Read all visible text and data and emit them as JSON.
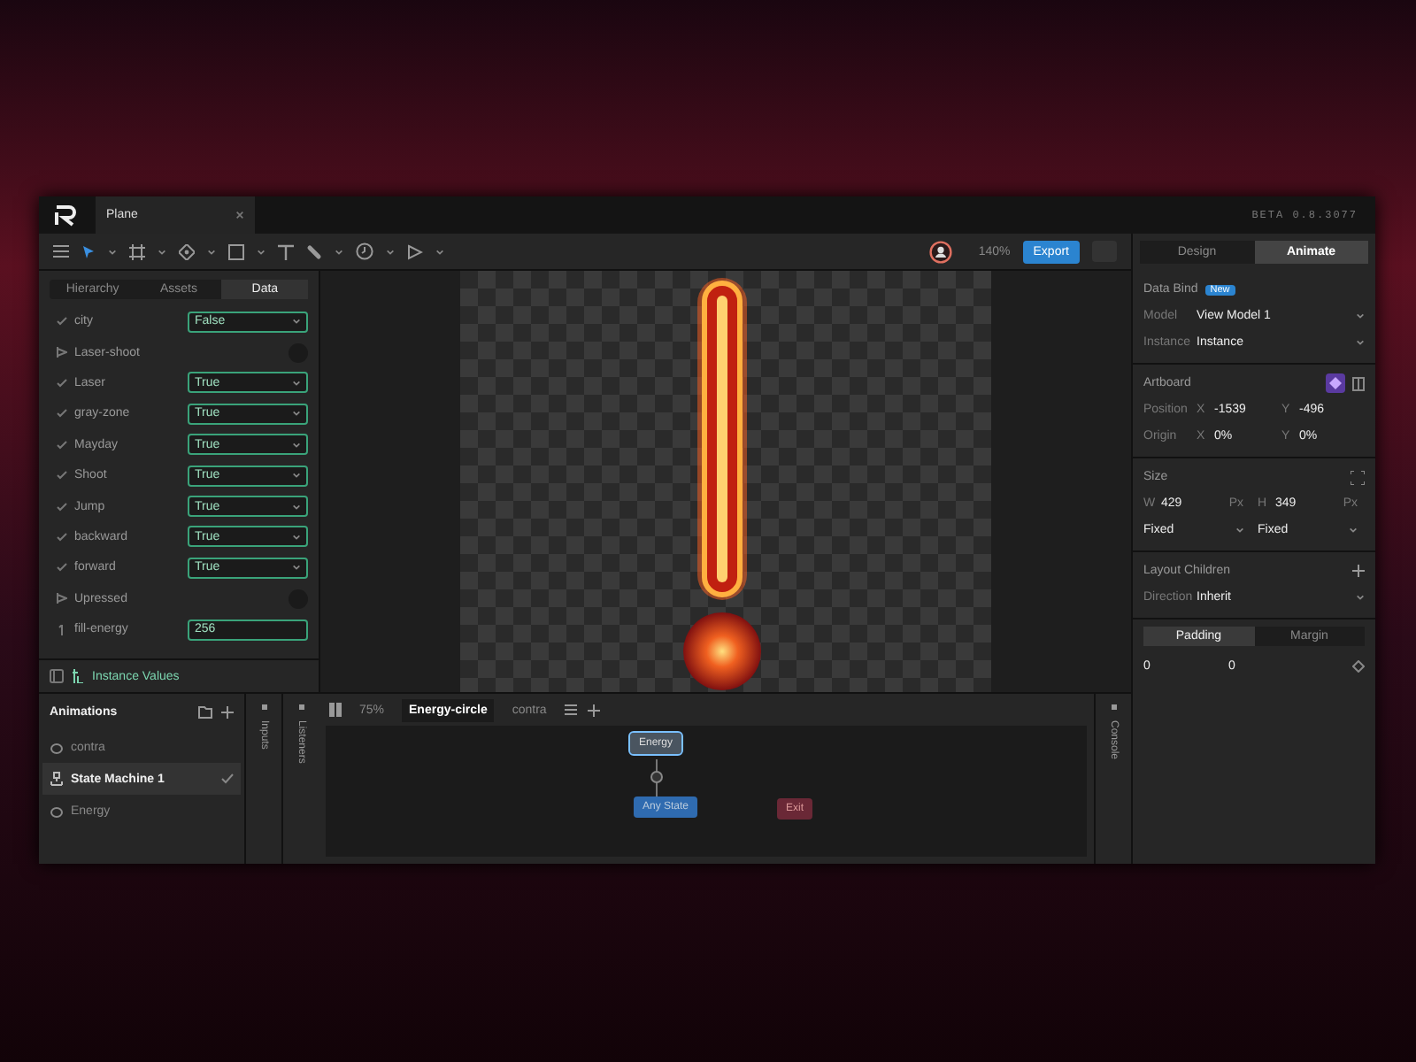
{
  "app_tab": {
    "title": "Plane"
  },
  "version": "BETA 0.8.3077",
  "toolbar": {
    "zoom": "140%",
    "export": "Export"
  },
  "mode_tabs": [
    {
      "label": "Design",
      "selected": false
    },
    {
      "label": "Animate",
      "selected": true
    }
  ],
  "panel_tabs": [
    {
      "label": "Hierarchy",
      "selected": false
    },
    {
      "label": "Assets",
      "selected": false
    },
    {
      "label": "Data",
      "selected": true
    }
  ],
  "data_rows": [
    {
      "kind": "bool",
      "name": "city",
      "value": "False"
    },
    {
      "kind": "trigger",
      "name": "Laser-shoot"
    },
    {
      "kind": "bool",
      "name": "Laser",
      "value": "True"
    },
    {
      "kind": "bool",
      "name": "gray-zone",
      "value": "True"
    },
    {
      "kind": "bool",
      "name": "Mayday",
      "value": "True"
    },
    {
      "kind": "bool",
      "name": "Shoot",
      "value": "True"
    },
    {
      "kind": "bool",
      "name": "Jump",
      "value": "True"
    },
    {
      "kind": "bool",
      "name": "backward",
      "value": "True"
    },
    {
      "kind": "bool",
      "name": "forward",
      "value": "True"
    },
    {
      "kind": "trigger",
      "name": "Upressed"
    },
    {
      "kind": "number",
      "name": "fill-energy",
      "value": "256"
    }
  ],
  "instance_values": "Instance Values",
  "animations": {
    "title": "Animations",
    "items": [
      {
        "kind": "animation",
        "name": "contra",
        "selected": false
      },
      {
        "kind": "state-machine",
        "name": "State Machine 1",
        "selected": true
      },
      {
        "kind": "animation",
        "name": "Energy",
        "selected": false
      }
    ]
  },
  "side_strips": [
    "Inputs",
    "Listeners"
  ],
  "console": "Console",
  "graph": {
    "zoom": "75%",
    "tabs": [
      {
        "label": "Energy-circle",
        "selected": true
      },
      {
        "label": "contra",
        "selected": false
      }
    ],
    "nodes": [
      {
        "kind": "animation",
        "label": "Energy",
        "selected": true
      },
      {
        "kind": "any",
        "label": "Any State",
        "selected": false
      },
      {
        "kind": "exit",
        "label": "Exit",
        "selected": false
      }
    ]
  },
  "properties": {
    "data_bind": {
      "title": "Data Bind",
      "badge": "New",
      "rows": [
        {
          "label": "Model",
          "value": "View Model 1"
        },
        {
          "label": "Instance",
          "value": "Instance"
        }
      ]
    },
    "artboard": {
      "title": "Artboard",
      "rows": [
        {
          "label": "Position",
          "fields": [
            {
              "axis": "X",
              "value": "-1539"
            },
            {
              "axis": "Y",
              "value": "-496"
            }
          ]
        },
        {
          "label": "Origin",
          "fields": [
            {
              "axis": "X",
              "value": "0%"
            },
            {
              "axis": "Y",
              "value": "0%"
            }
          ]
        }
      ]
    },
    "size": {
      "title": "Size",
      "fields": [
        {
          "axis": "W",
          "value": "429",
          "unit": "Px"
        },
        {
          "axis": "H",
          "value": "349",
          "unit": "Px"
        }
      ],
      "sizing": [
        "Fixed",
        "Fixed"
      ]
    },
    "layout": {
      "title": "Layout Children",
      "label": "Direction",
      "value": "Inherit"
    },
    "spacing_tabs": [
      {
        "label": "Padding",
        "selected": true
      },
      {
        "label": "Margin",
        "selected": false
      }
    ],
    "spacing_values": [
      "0",
      "0"
    ]
  }
}
